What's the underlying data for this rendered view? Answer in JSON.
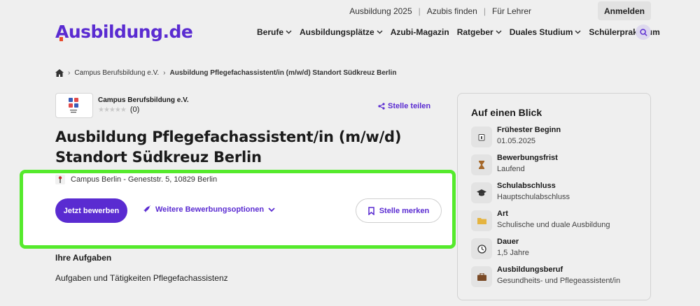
{
  "topbar": {
    "links": [
      "Ausbildung 2025",
      "Azubis finden",
      "Für Lehrer"
    ],
    "login_label": "Anmelden"
  },
  "logo": {
    "text": "Ausbildung.de"
  },
  "nav": {
    "items": [
      {
        "label": "Berufe",
        "dropdown": true
      },
      {
        "label": "Ausbildungsplätze",
        "dropdown": true
      },
      {
        "label": "Azubi-Magazin",
        "dropdown": false
      },
      {
        "label": "Ratgeber",
        "dropdown": true
      },
      {
        "label": "Duales Studium",
        "dropdown": true
      },
      {
        "label": "Schülerpraktikum",
        "dropdown": false
      }
    ]
  },
  "breadcrumb": {
    "company": "Campus Berufsbildung e.V.",
    "current": "Ausbildung Pflegefachassistent/in (m/w/d) Standort Südkreuz Berlin"
  },
  "company": {
    "name": "Campus Berufsbildung e.V.",
    "rating_count": "(0)",
    "rating_value": 0,
    "share_label": "Stelle teilen"
  },
  "job": {
    "title": "Ausbildung Pflegefachassistent/in (m/w/d) Standort Südkreuz Berlin",
    "location": "Campus Berlin - Geneststr. 5, 10829 Berlin",
    "apply_label": "Jetzt bewerben",
    "more_options_label": "Weitere Bewerbungsoptionen",
    "save_label": "Stelle merken"
  },
  "content": {
    "section_title": "Ihre Aufgaben",
    "section_text": "Aufgaben und Tätigkeiten Pflegefachassistenz"
  },
  "glance": {
    "title": "Auf einen Blick",
    "items": [
      {
        "icon": "calendar-icon",
        "label": "Frühester Beginn",
        "value": "01.05.2025"
      },
      {
        "icon": "hourglass-icon",
        "label": "Bewerbungsfrist",
        "value": "Laufend"
      },
      {
        "icon": "graduation-cap-icon",
        "label": "Schulabschluss",
        "value": "Hauptschulabschluss"
      },
      {
        "icon": "folder-icon",
        "label": "Art",
        "value": "Schulische und duale Ausbildung"
      },
      {
        "icon": "clock-icon",
        "label": "Dauer",
        "value": "1,5 Jahre"
      },
      {
        "icon": "briefcase-icon",
        "label": "Ausbildungsberuf",
        "value": "Gesundheits- und Pflegeassistent/in"
      }
    ]
  },
  "colors": {
    "brand": "#5a2bd1",
    "highlight": "#55ea2c",
    "logo_accent": "#e94b2c"
  }
}
